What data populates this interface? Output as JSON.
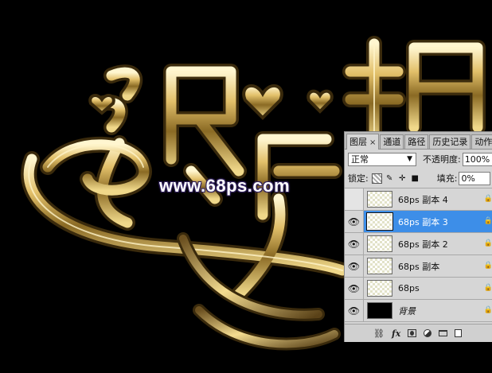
{
  "watermark": "www.68ps.com",
  "panel": {
    "tabs": [
      {
        "label": "图层",
        "close": "×"
      },
      {
        "label": "通道"
      },
      {
        "label": "路径"
      },
      {
        "label": "历史记录"
      },
      {
        "label": "动作"
      }
    ],
    "blend_mode": "正常",
    "opacity_label": "不透明度:",
    "opacity_value": "100%",
    "lock_label": "锁定:",
    "fill_label": "填充:",
    "fill_value": "0%",
    "layers": [
      {
        "name": "68ps 副本 4",
        "visible": false,
        "selected": false
      },
      {
        "name": "68ps 副本 3",
        "visible": true,
        "selected": true
      },
      {
        "name": "68ps 副本 2",
        "visible": true,
        "selected": false
      },
      {
        "name": "68ps  副本",
        "visible": true,
        "selected": false
      },
      {
        "name": "68ps",
        "visible": true,
        "selected": false
      },
      {
        "name": "背景",
        "visible": true,
        "selected": false,
        "background": true
      }
    ],
    "bottom_icons": [
      "link-icon",
      "fx-icon",
      "mask-icon",
      "adjustment-icon",
      "folder-icon",
      "new-layer-icon"
    ],
    "bottom_fx": "fx"
  },
  "colors": {
    "accent_selected": "#3d8ee8",
    "panel_bg": "#d6d6d6",
    "gold": "#d8b860"
  }
}
